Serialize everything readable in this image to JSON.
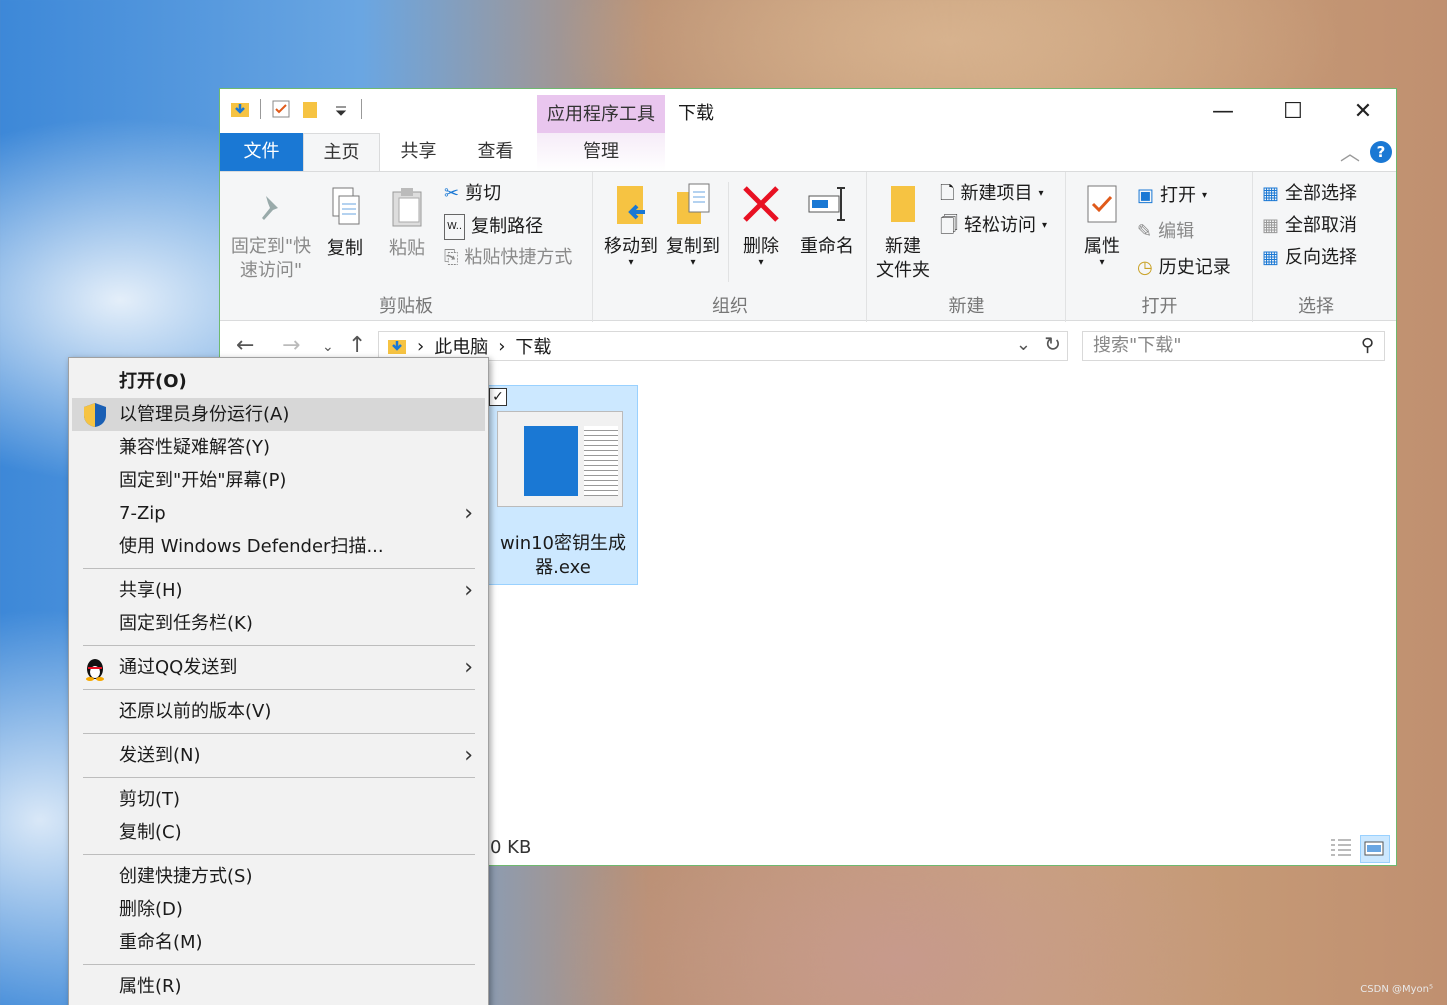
{
  "window": {
    "context_tab_title": "应用程序工具",
    "title": "下载",
    "tabs": {
      "file": "文件",
      "home": "主页",
      "share": "共享",
      "view": "查看",
      "manage": "管理"
    }
  },
  "ribbon": {
    "clipboard": {
      "label": "剪贴板",
      "pin_quick_access_1": "固定到\"快",
      "pin_quick_access_2": "速访问\"",
      "copy": "复制",
      "paste": "粘贴",
      "cut": "剪切",
      "copy_path": "复制路径",
      "paste_shortcut": "粘贴快捷方式"
    },
    "organize": {
      "label": "组织",
      "move_to": "移动到",
      "copy_to": "复制到",
      "delete": "删除",
      "rename": "重命名"
    },
    "new": {
      "label": "新建",
      "new_folder_1": "新建",
      "new_folder_2": "文件夹",
      "new_item": "新建项目",
      "easy_access": "轻松访问"
    },
    "open": {
      "label": "打开",
      "properties": "属性",
      "open": "打开",
      "edit": "编辑",
      "history": "历史记录"
    },
    "select": {
      "label": "选择",
      "select_all": "全部选择",
      "select_none": "全部取消",
      "invert": "反向选择"
    }
  },
  "address": {
    "crumb_pc": "此电脑",
    "crumb_downloads": "下载",
    "search_placeholder": "搜索\"下载\""
  },
  "files": [
    {
      "name_line1": "win10密钥生成",
      "name_line2": "器.exe"
    }
  ],
  "status": {
    "size": "0 KB"
  },
  "context_menu": {
    "open": "打开(O)",
    "run_as_admin": "以管理员身份运行(A)",
    "troubleshoot": "兼容性疑难解答(Y)",
    "pin_start": "固定到\"开始\"屏幕(P)",
    "zip": "7-Zip",
    "defender": "使用 Windows Defender扫描...",
    "share": "共享(H)",
    "pin_taskbar": "固定到任务栏(K)",
    "qq_send": "通过QQ发送到",
    "restore_versions": "还原以前的版本(V)",
    "send_to": "发送到(N)",
    "cut": "剪切(T)",
    "copy": "复制(C)",
    "create_shortcut": "创建快捷方式(S)",
    "delete": "删除(D)",
    "rename": "重命名(M)",
    "properties": "属性(R)"
  },
  "watermark": "CSDN @Myon⁵",
  "colors": {
    "accent": "#1a78d4",
    "context_tab": "#e9c6ee",
    "selection": "#cce8ff",
    "menu_highlight": "#d7d7d7"
  }
}
